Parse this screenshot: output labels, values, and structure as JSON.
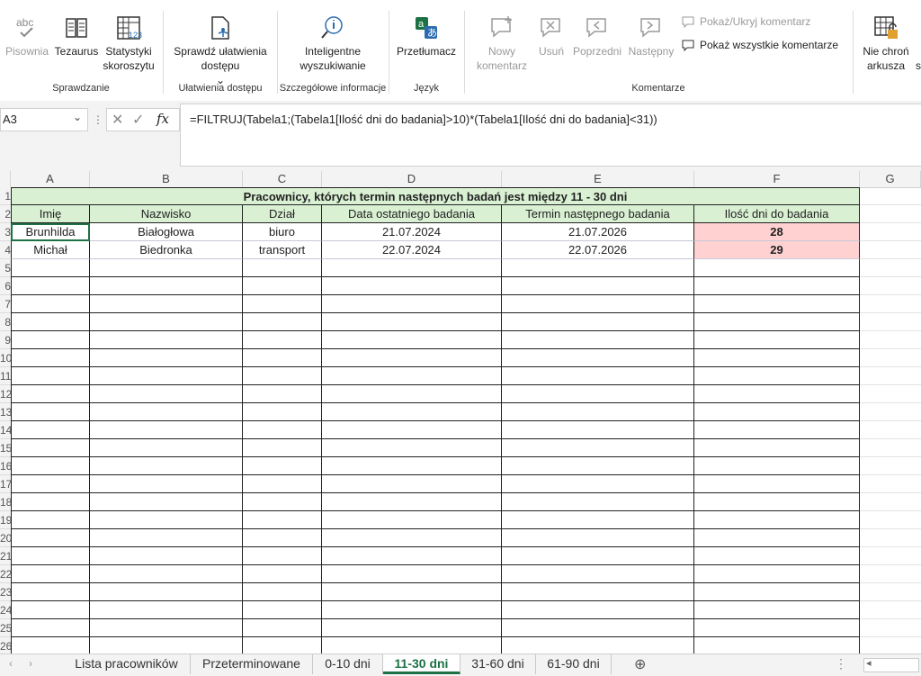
{
  "ribbon": {
    "buttons": [
      {
        "label": "Pisownia",
        "icon": "spelling-icon",
        "disabled": true
      },
      {
        "label": "Tezaurus",
        "icon": "thesaurus-icon",
        "disabled": false
      },
      {
        "label": "Statystyki skoroszytu",
        "icon": "workbook-statistics-icon",
        "disabled": false
      },
      {
        "label": "Sprawdź ułatwienia dostępu",
        "icon": "accessibility-check-icon",
        "disabled": false
      },
      {
        "label": "Inteligentne wyszukiwanie",
        "icon": "smart-lookup-icon",
        "disabled": false
      },
      {
        "label": "Przetłumacz",
        "icon": "translate-icon",
        "disabled": false
      },
      {
        "label": "Nowy komentarz",
        "icon": "new-comment-icon",
        "disabled": true
      },
      {
        "label": "Usuń",
        "icon": "delete-comment-icon",
        "disabled": true
      },
      {
        "label": "Poprzedni",
        "icon": "previous-comment-icon",
        "disabled": true
      },
      {
        "label": "Następny",
        "icon": "next-comment-icon",
        "disabled": true
      },
      {
        "label": "Nie chroń arkusza",
        "icon": "unprotect-sheet-icon",
        "disabled": false
      }
    ],
    "small_items": {
      "show_hide_comment": "Pokaż/Ukryj komentarz",
      "show_all_comments": "Pokaż wszystkie komentarze"
    },
    "groups": [
      "Sprawdzanie",
      "Ułatwienia dostępu",
      "Szczegółowe informacje",
      "Język",
      "Komentarze"
    ]
  },
  "formula_bar": {
    "name_box": "A3",
    "formula": "=FILTRUJ(Tabela1;(Tabela1[Ilość dni  do badania]>10)*(Tabela1[Ilość dni  do badania]<31))"
  },
  "columns": [
    "A",
    "B",
    "C",
    "D",
    "E",
    "F",
    "G"
  ],
  "row_numbers": [
    "1",
    "2",
    "3",
    "4",
    "5",
    "6",
    "7",
    "8",
    "9",
    "10",
    "11",
    "12",
    "13",
    "14",
    "15",
    "16",
    "17",
    "18",
    "19",
    "20",
    "21",
    "22",
    "23",
    "24",
    "25",
    "26"
  ],
  "table": {
    "title": "Pracownicy, których termin następnych badań jest między 11 - 30 dni",
    "headers": [
      "Imię",
      "Nazwisko",
      "Dział",
      "Data ostatniego badania",
      "Termin następnego badania",
      "Ilość dni  do badania"
    ],
    "rows": [
      [
        "Brunhilda",
        "Białogłowa",
        "biuro",
        "21.07.2024",
        "21.07.2026",
        "28"
      ],
      [
        "Michał",
        "Biedronka",
        "transport",
        "22.07.2024",
        "22.07.2026",
        "29"
      ]
    ]
  },
  "sheets": [
    "Lista pracowników",
    "Przeterminowane",
    "0-10 dni",
    "11-30 dni",
    "31-60 dni",
    "61-90 dni"
  ],
  "active_sheet": "11-30 dni",
  "colors": {
    "accent": "#1e7145",
    "header_fill": "#d9f0d3",
    "highlight_fill": "#ffd1d1"
  }
}
